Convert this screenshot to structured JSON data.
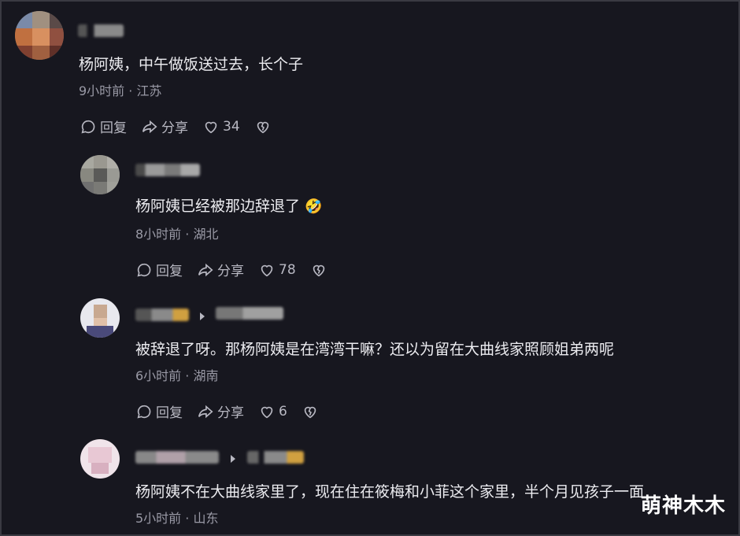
{
  "comments": [
    {
      "text": "杨阿姨，中午做饭送过去，长个子",
      "time": "9小时前",
      "location": "江苏",
      "reply_label": "回复",
      "share_label": "分享",
      "likes": "34"
    },
    {
      "text": "杨阿姨已经被那边辞退了",
      "emoji": "🤣",
      "time": "8小时前",
      "location": "湖北",
      "reply_label": "回复",
      "share_label": "分享",
      "likes": "78"
    },
    {
      "text": "被辞退了呀。那杨阿姨是在湾湾干嘛？还以为留在大曲线家照顾姐弟两呢",
      "time": "6小时前",
      "location": "湖南",
      "reply_label": "回复",
      "share_label": "分享",
      "likes": "6"
    },
    {
      "text": "杨阿姨不在大曲线家里了，现在住在筱梅和小菲这个家里，半个月见孩子一面",
      "time": "5小时前",
      "location": "山东"
    }
  ],
  "separator": "·",
  "watermark": "萌神木木",
  "colors": {
    "background": "#17171f",
    "text": "#ececf0",
    "meta": "#9a9aa6"
  }
}
